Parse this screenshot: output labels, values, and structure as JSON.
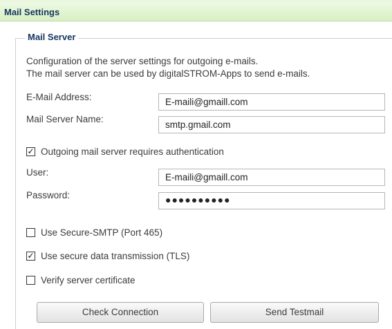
{
  "panel": {
    "title": "Mail Settings"
  },
  "mail_server": {
    "legend": "Mail Server",
    "description_line1": "Configuration of the server settings for outgoing e-mails.",
    "description_line2": "The mail server can be used by digitalSTROM-Apps to send e-mails.",
    "email_label": "E-Mail Address:",
    "email_value": "E-maili@gmaill.com",
    "server_label": "Mail Server Name:",
    "server_value": "smtp.gmail.com",
    "auth_check": {
      "label": "Outgoing mail server requires authentication",
      "checked": true,
      "mark": "✓"
    },
    "user_label": "User:",
    "user_value": "E-maili@gmaill.com",
    "password_label": "Password:",
    "password_value": "●●●●●●●●●●",
    "secure_smtp": {
      "label": "Use Secure-SMTP (Port 465)",
      "checked": false,
      "mark": ""
    },
    "tls": {
      "label": "Use secure data transmission (TLS)",
      "checked": true,
      "mark": "✓"
    },
    "verify_cert": {
      "label": "Verify server certificate",
      "checked": false,
      "mark": ""
    }
  },
  "buttons": {
    "check_connection": "Check Connection",
    "send_testmail": "Send Testmail"
  }
}
